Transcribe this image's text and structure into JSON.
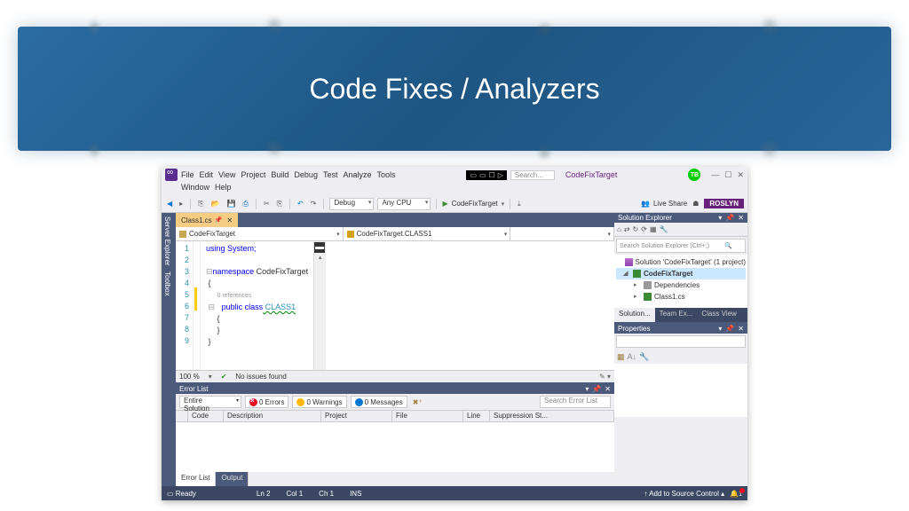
{
  "banner": {
    "title": "Code Fixes / Analyzers"
  },
  "ide": {
    "solution_name": "CodeFixTarget",
    "menu1": [
      "File",
      "Edit",
      "View",
      "Project",
      "Build",
      "Debug",
      "Test",
      "Analyze",
      "Tools"
    ],
    "menu2": [
      "Window",
      "Help"
    ],
    "search_placeholder": "Search...",
    "user_badge": "TB",
    "toolbar": {
      "config": "Debug",
      "platform": "Any CPU",
      "run_target": "CodeFixTarget",
      "live_share": "Live Share",
      "account_pill": "ROSLYN"
    },
    "side_tabs": [
      "Server Explorer",
      "Toolbox"
    ],
    "file_tab": "Class1.cs",
    "nav": {
      "scope": "CodeFixTarget",
      "member": "CodeFixTarget.CLASS1"
    },
    "code": {
      "lines": [
        "1",
        "2",
        "3",
        "4",
        "5",
        "6",
        "7",
        "8",
        "9"
      ],
      "l1": "using System;",
      "l3a": "namespace",
      "l3b": " CodeFixTarget",
      "l4": "{",
      "lens": "0 references",
      "l5a": "public class",
      "l5b": " CLASS1",
      "l6": "{",
      "l7": "}",
      "l8": "}"
    },
    "editor_status": {
      "zoom": "100 %",
      "issues": "No issues found"
    },
    "error_list": {
      "title": "Error List",
      "scope": "Entire Solution",
      "errors": "0 Errors",
      "warnings": "0 Warnings",
      "messages": "0 Messages",
      "search_placeholder": "Search Error List",
      "columns": [
        "",
        "Code",
        "Description",
        "Project",
        "File",
        "Line",
        "Suppression St..."
      ],
      "tabs": [
        "Error List",
        "Output"
      ]
    },
    "solution_explorer": {
      "title": "Solution Explorer",
      "search_placeholder": "Search Solution Explorer (Ctrl+;)",
      "root": "Solution 'CodeFixTarget' (1 project)",
      "project": "CodeFixTarget",
      "dependencies": "Dependencies",
      "file": "Class1.cs",
      "tabs": [
        "Solution...",
        "Team Ex...",
        "Class View"
      ]
    },
    "properties": {
      "title": "Properties"
    },
    "statusbar": {
      "ready": "Ready",
      "ln": "Ln 2",
      "col": "Col 1",
      "ch": "Ch 1",
      "ins": "INS",
      "source_control": "Add to Source Control",
      "notifications": "1"
    }
  }
}
